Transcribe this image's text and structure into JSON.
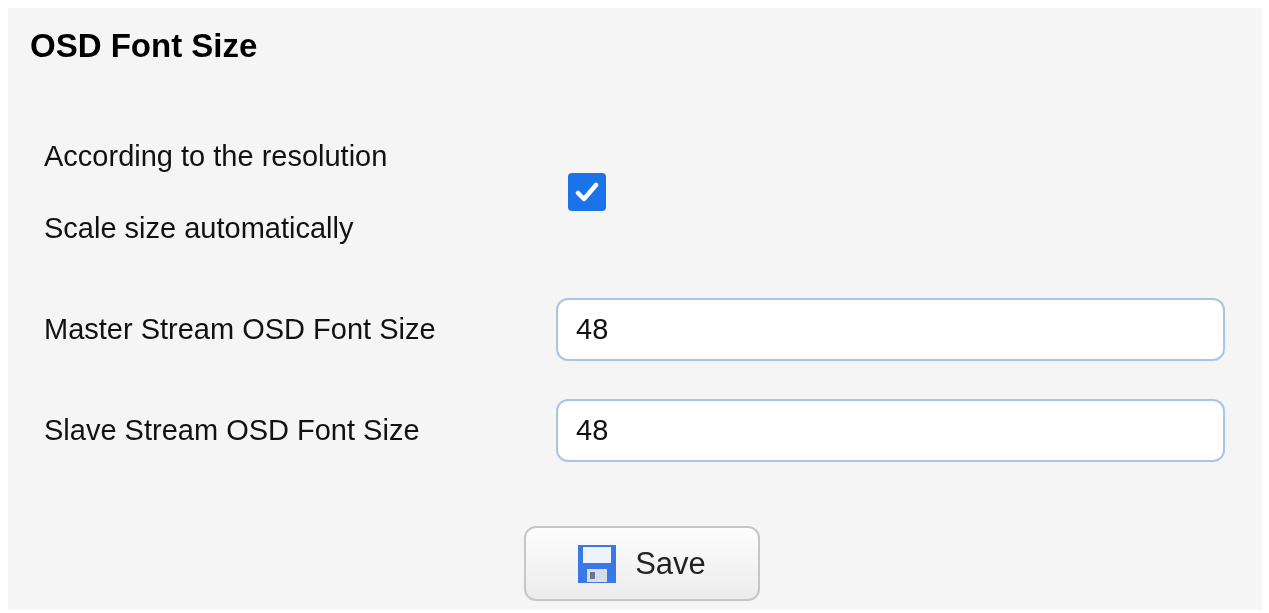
{
  "title": "OSD Font Size",
  "auto_scale": {
    "label_lines": [
      "According to the resolution",
      "Scale size automatically"
    ],
    "checked": true
  },
  "fields": [
    {
      "label": "Master Stream OSD Font Size",
      "value": "48"
    },
    {
      "label": "Slave Stream OSD Font Size",
      "value": "48"
    }
  ],
  "save_button": {
    "label": "Save"
  }
}
